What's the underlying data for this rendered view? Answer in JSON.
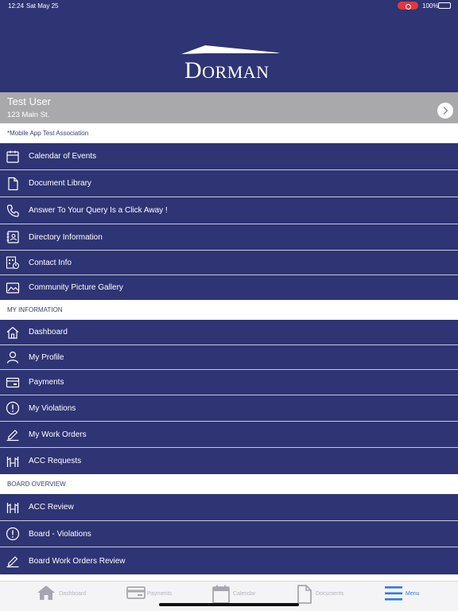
{
  "status_bar": {
    "time": "12:24",
    "date": "Sat May 25",
    "battery": "100%"
  },
  "header": {
    "logo_text": "DORMAN"
  },
  "user": {
    "name": "Test User",
    "address": "123 Main St."
  },
  "association": "*Mobile App Test Association",
  "community_items": [
    {
      "label": "Calendar of Events",
      "icon": "calendar-icon"
    },
    {
      "label": "Document Library",
      "icon": "document-icon"
    },
    {
      "label": "Answer To Your Query Is a Click Away !",
      "icon": "phone-icon"
    },
    {
      "label": "Directory Information",
      "icon": "contact-book-icon"
    },
    {
      "label": "Contact Info",
      "icon": "building-contact-icon"
    },
    {
      "label": "Community Picture Gallery",
      "icon": "picture-gallery-icon"
    }
  ],
  "my_information": {
    "title": "MY INFORMATION",
    "items": [
      {
        "label": "Dashboard",
        "icon": "home-icon"
      },
      {
        "label": "My Profile",
        "icon": "person-icon"
      },
      {
        "label": "Payments",
        "icon": "payment-card-icon"
      },
      {
        "label": "My Violations",
        "icon": "exclamation-circle-icon"
      },
      {
        "label": "My Work Orders",
        "icon": "pen-edit-icon"
      },
      {
        "label": "ACC Requests",
        "icon": "acc-building-icon"
      }
    ]
  },
  "board_overview": {
    "title": "BOARD OVERVIEW",
    "items": [
      {
        "label": "ACC Review",
        "icon": "acc-building-icon"
      },
      {
        "label": "Board - Violations",
        "icon": "exclamation-circle-icon"
      },
      {
        "label": "Board Work Orders Review",
        "icon": "pen-edit-icon"
      }
    ]
  },
  "tabs": [
    {
      "label": "Dashboard",
      "icon": "home-icon",
      "active": false
    },
    {
      "label": "Payments",
      "icon": "payment-card-icon",
      "active": false
    },
    {
      "label": "Calendar",
      "icon": "calendar-icon",
      "active": false
    },
    {
      "label": "Documents",
      "icon": "document-icon",
      "active": false
    },
    {
      "label": "Menu",
      "icon": "menu-icon",
      "active": true
    }
  ],
  "colors": {
    "primary": "#2e3474",
    "user_bar": "#a9a9ab",
    "tab_active": "#2f7be0",
    "tab_inactive": "#b4b4bc"
  }
}
